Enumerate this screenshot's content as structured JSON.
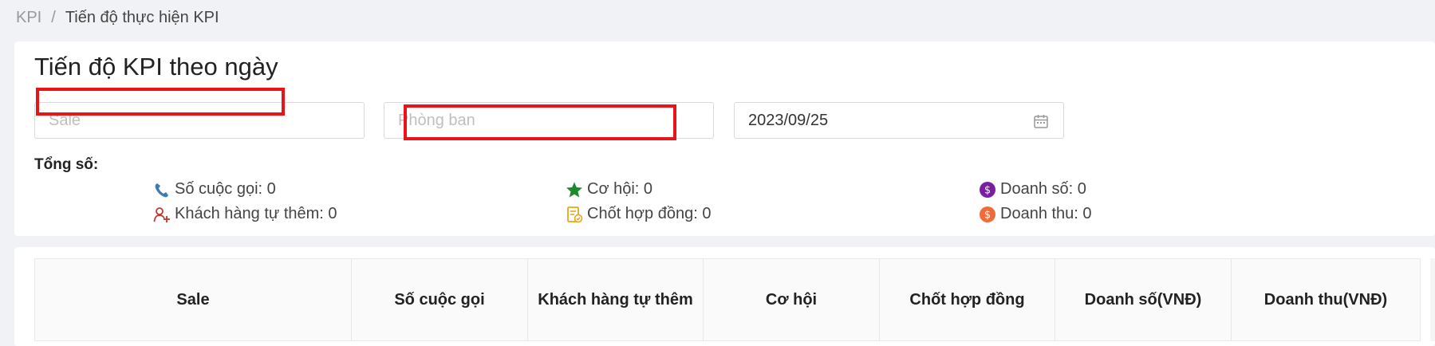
{
  "breadcrumb": {
    "root": "KPI",
    "separator": "/",
    "current": "Tiến độ thực hiện KPI"
  },
  "page": {
    "title": "Tiến độ KPI theo ngày"
  },
  "filters": {
    "sale_placeholder": "Sale",
    "department_placeholder": "Phòng ban",
    "date_value": "2023/09/25",
    "date_icon": "calendar-icon"
  },
  "summary": {
    "label": "Tổng số:",
    "calls": "Số cuộc gọi: 0",
    "self_added_customers": "Khách hàng tự thêm: 0",
    "opportunities": "Cơ hội: 0",
    "closed_contracts": "Chốt hợp đồng: 0",
    "sales": "Doanh số: 0",
    "revenue": "Doanh thu: 0",
    "icons": {
      "calls": "phone-icon",
      "self_added_customers": "user-add-icon",
      "opportunities": "star-icon",
      "closed_contracts": "contract-icon",
      "sales": "dollar-circle-icon",
      "revenue": "dollar-circle-icon"
    },
    "colors": {
      "phone": "#3d7ab8",
      "user_add": "#c0392b",
      "star": "#1a8a2a",
      "contract": "#e6a817",
      "sales": "#7b1fa2",
      "revenue": "#f06a3a"
    }
  },
  "table": {
    "columns": [
      "Sale",
      "Số cuộc gọi",
      "Khách hàng tự thêm",
      "Cơ hội",
      "Chốt hợp đồng",
      "Doanh số(VNĐ)",
      "Doanh thu(VNĐ)"
    ]
  },
  "highlight_color": "#e8141a"
}
